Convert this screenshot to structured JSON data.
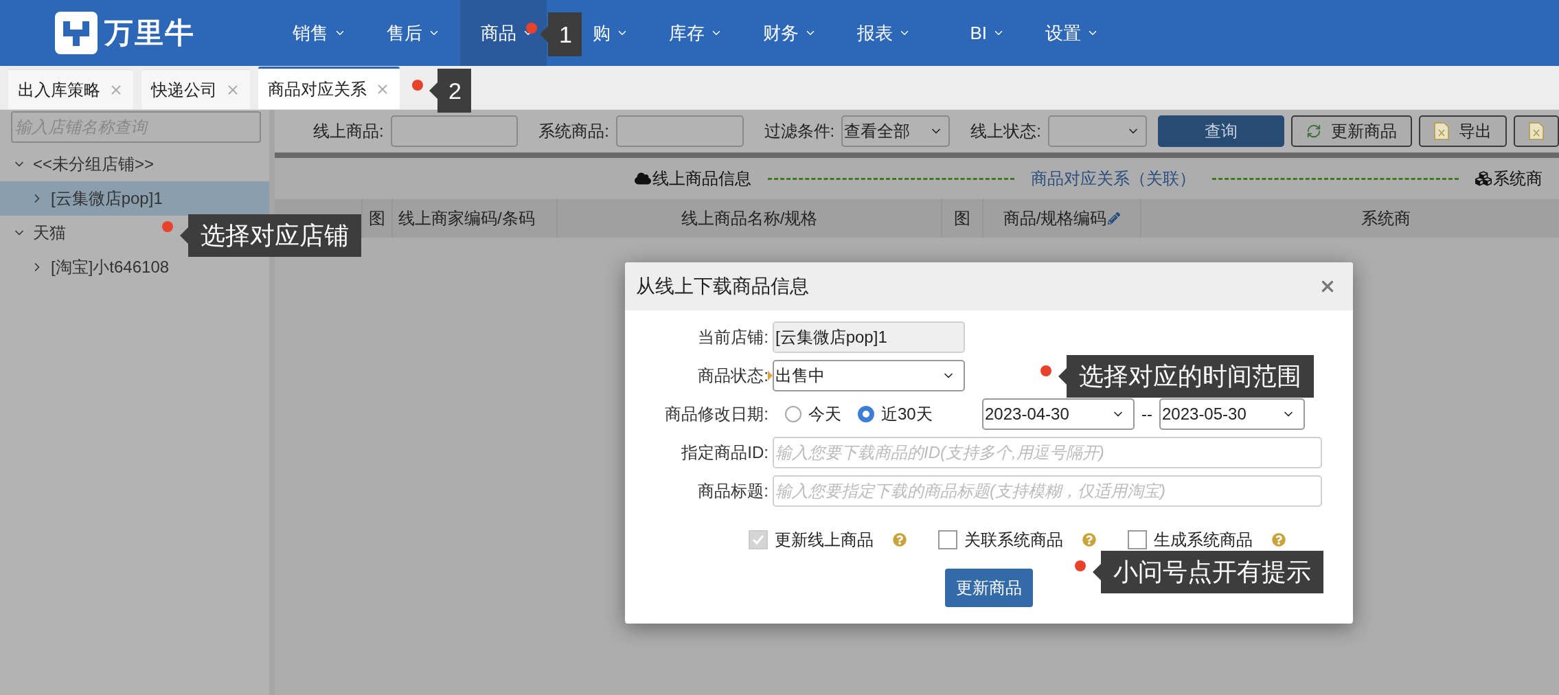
{
  "logo": {
    "text": "万里牛"
  },
  "nav": [
    {
      "label": "销售",
      "selected": false
    },
    {
      "label": "售后",
      "selected": false
    },
    {
      "label": "商品",
      "selected": true
    },
    {
      "label": "购",
      "selected": false
    },
    {
      "label": "库存",
      "selected": false
    },
    {
      "label": "财务",
      "selected": false
    },
    {
      "label": "报表",
      "selected": false
    },
    {
      "label": "BI",
      "selected": false
    },
    {
      "label": "设置",
      "selected": false
    }
  ],
  "tabs": [
    {
      "label": "出入库策略",
      "selected": false
    },
    {
      "label": "快递公司",
      "selected": false
    },
    {
      "label": "商品对应关系",
      "selected": true
    }
  ],
  "sidebar": {
    "search": {
      "placeholder": "输入店铺名称查询"
    },
    "tree": [
      {
        "label": "<<未分组店铺>>",
        "expanded": true,
        "selected": false,
        "children": [
          {
            "label": "[云集微店pop]1",
            "expanded": false,
            "selected": true
          }
        ]
      },
      {
        "label": "天猫",
        "expanded": true,
        "selected": false,
        "children": [
          {
            "label": "[淘宝]小t646108",
            "expanded": false,
            "selected": false
          }
        ]
      }
    ]
  },
  "toolbar": {
    "fields": [
      {
        "kind": "input",
        "label": "线上商品:"
      },
      {
        "kind": "input",
        "label": "系统商品:"
      },
      {
        "kind": "select",
        "label": "过滤条件:",
        "value": "查看全部"
      },
      {
        "kind": "select",
        "label": "线上状态:"
      }
    ],
    "buttons": [
      {
        "kind": "primary",
        "label": "查询"
      },
      {
        "kind": "refresh",
        "label": "更新商品"
      },
      {
        "kind": "excel",
        "label": "导出"
      },
      {
        "kind": "excel"
      }
    ]
  },
  "sections": [
    {
      "kind": "cloud",
      "label": "线上商品信息"
    },
    {
      "kind": "link",
      "label": "商品对应关系（关联）"
    },
    {
      "kind": "cubes",
      "label": "系统商"
    }
  ],
  "table": {
    "columns": [
      {
        "kind": "blank"
      },
      {
        "kind": "text",
        "label": "图"
      },
      {
        "kind": "text",
        "label": "线上商家编码/条码"
      },
      {
        "kind": "text",
        "label": "线上商品名称/规格"
      },
      {
        "kind": "text",
        "label": "图"
      },
      {
        "kind": "edit",
        "label": "商品/规格编码"
      },
      {
        "kind": "text",
        "label": "系统商"
      }
    ]
  },
  "dialog": {
    "title": "从线上下载商品信息",
    "store": {
      "label": "当前店铺:",
      "value": "[云集微店pop]1"
    },
    "status": {
      "label": "商品状态:",
      "value": "出售中"
    },
    "date": {
      "label": "商品修改日期:",
      "options": [
        {
          "label": "今天",
          "selected": false
        },
        {
          "label": "近30天",
          "selected": true
        }
      ],
      "from": "2023-04-30",
      "separator": "--",
      "to": "2023-05-30"
    },
    "ids": {
      "label": "指定商品ID:",
      "placeholder": "输入您要下载商品的ID(支持多个,用逗号隔开)"
    },
    "title_field": {
      "label": "商品标题:",
      "placeholder": "输入您要指定下载的商品标题(支持模糊，仅适用淘宝)"
    },
    "checkboxes": [
      {
        "label": "更新线上商品",
        "checked": true,
        "disabled": true
      },
      {
        "label": "关联系统商品",
        "checked": false,
        "disabled": false
      },
      {
        "label": "生成系统商品",
        "checked": false,
        "disabled": false
      }
    ],
    "button": "更新商品"
  },
  "annotations": [
    {
      "text": "1",
      "kind": "nav"
    },
    {
      "text": "2",
      "kind": "tab"
    },
    {
      "text": "选择对应店铺",
      "kind": "sidebar"
    },
    {
      "text": "选择对应的时间范围",
      "kind": "date"
    },
    {
      "text": "小问号点开有提示",
      "kind": "help"
    }
  ]
}
